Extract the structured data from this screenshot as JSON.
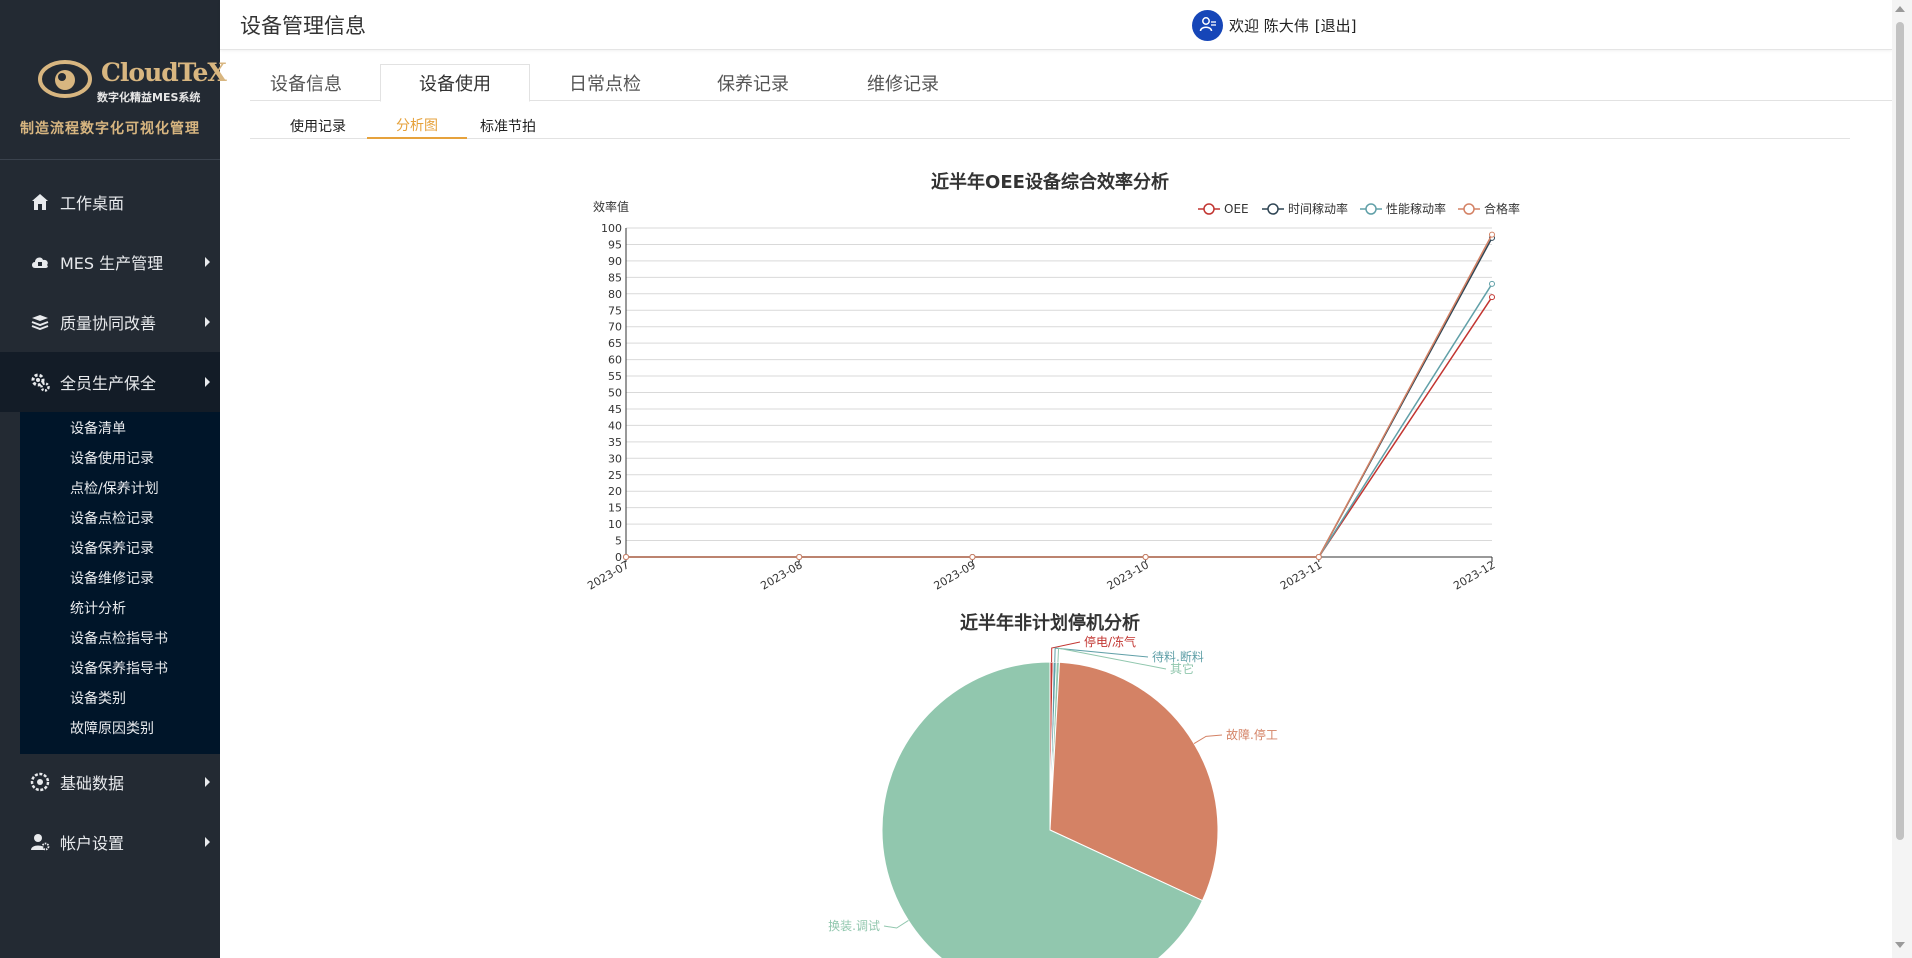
{
  "brand": {
    "name": "CloudTeX",
    "subtitle": "数字化精益MES系统",
    "slogan": "制造流程数字化可视化管理",
    "gold_color": "#d8b680"
  },
  "sidebar": {
    "bg_color": "#232a33",
    "submenu_bg_color": "#001529",
    "items": [
      {
        "label": "工作桌面",
        "icon": "home-icon"
      },
      {
        "label": "MES 生产管理",
        "icon": "cloud-icon"
      },
      {
        "label": "质量协同改善",
        "icon": "layers-icon"
      },
      {
        "label": "全员生产保全",
        "icon": "gears-icon"
      },
      {
        "label": "基础数据",
        "icon": "settings-icon"
      },
      {
        "label": "帐户设置",
        "icon": "user-gear-icon"
      }
    ],
    "submenu": [
      "设备清单",
      "设备使用记录",
      "点检/保养计划",
      "设备点检记录",
      "设备保养记录",
      "设备维修记录",
      "统计分析",
      "设备点检指导书",
      "设备保养指导书",
      "设备类别",
      "故障原因类别"
    ]
  },
  "header": {
    "title": "设备管理信息",
    "welcome": "欢迎 陈大伟",
    "logout": "[退出]"
  },
  "tabs": [
    "设备信息",
    "设备使用",
    "日常点检",
    "保养记录",
    "维修记录"
  ],
  "active_tab": "设备使用",
  "subtabs": [
    "使用记录",
    "分析图",
    "标准节拍"
  ],
  "active_subtab": "分析图",
  "accent_color": "#e6a23c",
  "chart_data": [
    {
      "type": "line",
      "title": "近半年OEE设备综合效率分析",
      "ylabel": "效率值",
      "xlabel": "",
      "categories": [
        "2023-07",
        "2023-08",
        "2023-09",
        "2023-10",
        "2023-11",
        "2023-12"
      ],
      "ylim": [
        0,
        100
      ],
      "ytick_step": 5,
      "grid": true,
      "legend_position": "top-right",
      "series": [
        {
          "name": "OEE",
          "color": "#c23531",
          "values": [
            0,
            0,
            0,
            0,
            0,
            79
          ]
        },
        {
          "name": "时间稼动率",
          "color": "#2f4554",
          "values": [
            0,
            0,
            0,
            0,
            0,
            97
          ]
        },
        {
          "name": "性能稼动率",
          "color": "#61a0a8",
          "values": [
            0,
            0,
            0,
            0,
            0,
            83
          ]
        },
        {
          "name": "合格率",
          "color": "#d48265",
          "values": [
            0,
            0,
            0,
            0,
            0,
            98
          ]
        }
      ]
    },
    {
      "type": "pie",
      "title": "近半年非计划停机分析",
      "legend_position": "none",
      "slices": [
        {
          "name": "停电/冻气",
          "value": 0.3,
          "color": "#c23531"
        },
        {
          "name": "待料.断料",
          "value": 0.3,
          "color": "#61a0a8"
        },
        {
          "name": "其它",
          "value": 0.3,
          "color": "#91c7ae"
        },
        {
          "name": "故障.停工",
          "value": 31,
          "color": "#d48265"
        },
        {
          "name": "换装.调试",
          "value": 68.1,
          "color": "#91c7ae"
        }
      ]
    }
  ]
}
